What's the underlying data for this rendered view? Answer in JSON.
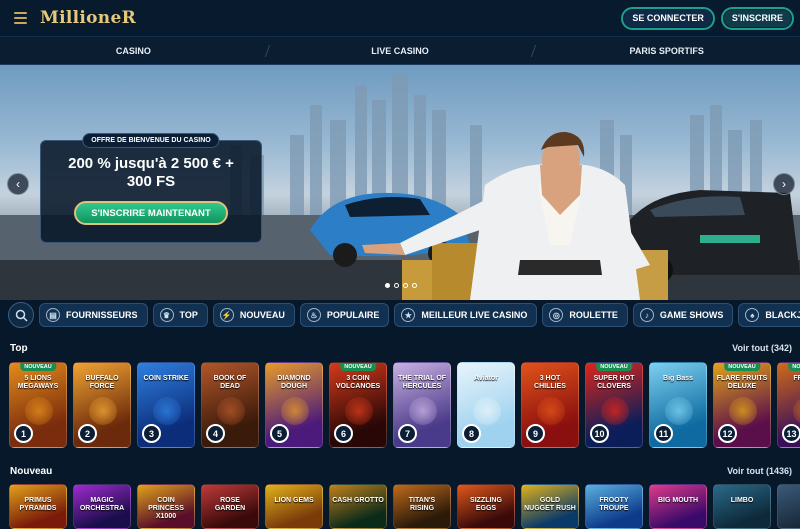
{
  "header": {
    "logo": "MillioneR",
    "login_label": "SE CONNECTER",
    "register_label": "S'INSCRIRE",
    "accent": "#1c9f8b"
  },
  "nav": {
    "items": [
      {
        "label": "CASINO"
      },
      {
        "label": "LIVE CASINO"
      },
      {
        "label": "PARIS SPORTIFS"
      }
    ]
  },
  "hero": {
    "tag": "OFFRE DE BIENVENUE DU CASINO",
    "title_line1": "200 % jusqu'à 2 500 € +",
    "title_line2": "300 FS",
    "cta": "S'INSCRIRE MAINTENANT",
    "prev_icon": "chevron-left-icon",
    "next_icon": "chevron-right-icon",
    "slide_dots": 4,
    "active_dot": 1
  },
  "filters": {
    "search_icon": "search-icon",
    "chips": [
      {
        "label": "FOURNISSEURS",
        "icon": "providers-icon",
        "glyph": "▤"
      },
      {
        "label": "TOP",
        "icon": "crown-icon",
        "glyph": "♛"
      },
      {
        "label": "NOUVEAU",
        "icon": "lightning-icon",
        "glyph": "⚡"
      },
      {
        "label": "POPULAIRE",
        "icon": "flame-icon",
        "glyph": "♨"
      },
      {
        "label": "MEILLEUR LIVE CASINO",
        "icon": "star-icon",
        "glyph": "★"
      },
      {
        "label": "ROULETTE",
        "icon": "roulette-icon",
        "glyph": "◎"
      },
      {
        "label": "GAME SHOWS",
        "icon": "microphone-icon",
        "glyph": "♪"
      },
      {
        "label": "BLACKJACK",
        "icon": "cards-icon",
        "glyph": "♠"
      }
    ]
  },
  "top": {
    "title": "Top",
    "more": "Voir tout (342)",
    "games": [
      {
        "name": "5 LIONS MEGAWAYS",
        "new": true,
        "rank": "1",
        "c1": "#7a2c0d",
        "c2": "#e38b1c"
      },
      {
        "name": "BUFFALO FORCE",
        "new": false,
        "rank": "2",
        "c1": "#6b2a0b",
        "c2": "#f0a432"
      },
      {
        "name": "COIN STRIKE",
        "new": false,
        "rank": "3",
        "c1": "#0b2d7a",
        "c2": "#2f7fe0"
      },
      {
        "name": "BOOK OF DEAD",
        "new": false,
        "rank": "4",
        "c1": "#3a1a0a",
        "c2": "#b2562a"
      },
      {
        "name": "DIAMOND DOUGH",
        "new": false,
        "rank": "5",
        "c1": "#4b1a7a",
        "c2": "#e79a2a"
      },
      {
        "name": "3 COIN VOLCANOES",
        "new": true,
        "rank": "6",
        "c1": "#2a0707",
        "c2": "#d43a1a"
      },
      {
        "name": "THE TRIAL OF HERCULES",
        "new": false,
        "rank": "7",
        "c1": "#4a3a8a",
        "c2": "#c8b0e0"
      },
      {
        "name": "Aviator",
        "new": false,
        "rank": "8",
        "c1": "#9fd2ef",
        "c2": "#e8f4fb"
      },
      {
        "name": "3 HOT CHILLIES",
        "new": false,
        "rank": "9",
        "c1": "#8a0f0f",
        "c2": "#e0531a"
      },
      {
        "name": "SUPER HOT CLOVERS",
        "new": true,
        "rank": "10",
        "c1": "#0b1e5a",
        "c2": "#e0251a"
      },
      {
        "name": "Big Bass",
        "new": false,
        "rank": "11",
        "c1": "#0e6aa0",
        "c2": "#7cd0f0"
      },
      {
        "name": "FLARE FRUITS DELUXE",
        "new": true,
        "rank": "12",
        "c1": "#5a0e4a",
        "c2": "#e0a21a"
      },
      {
        "name": "FRUITS",
        "new": true,
        "rank": "13",
        "c1": "#3a0e5a",
        "c2": "#d06a1a"
      }
    ]
  },
  "new_section": {
    "title": "Nouveau",
    "more": "Voir tout (1436)",
    "games": [
      {
        "name": "PRIMUS PYRAMIDS",
        "c1": "#7a1a0a",
        "c2": "#e0a21a"
      },
      {
        "name": "MAGIC ORCHESTRA",
        "c1": "#1a0e4a",
        "c2": "#a02ad0"
      },
      {
        "name": "COIN PRINCESS X1000",
        "c1": "#5a0e2a",
        "c2": "#e0a21a"
      },
      {
        "name": "ROSE GARDEN",
        "c1": "#3a0a0a",
        "c2": "#c03a3a"
      },
      {
        "name": "LION GEMS",
        "c1": "#7a3a0a",
        "c2": "#e0b21a"
      },
      {
        "name": "CASH GROTTO",
        "c1": "#0a2a1a",
        "c2": "#c0801a"
      },
      {
        "name": "TITAN'S RISING",
        "c1": "#2a1a0a",
        "c2": "#c06a1a"
      },
      {
        "name": "SIZZLING EGGS",
        "c1": "#3a0a0a",
        "c2": "#e0581a"
      },
      {
        "name": "GOLD NUGGET RUSH",
        "c1": "#0a3a6a",
        "c2": "#e0b21a"
      },
      {
        "name": "FROOTY TROUPE",
        "c1": "#0e3a8a",
        "c2": "#5ab0e0"
      },
      {
        "name": "BIG MOUTH",
        "c1": "#3a0a6a",
        "c2": "#e03a8a"
      },
      {
        "name": "LIMBO",
        "c1": "#0e2a3a",
        "c2": "#2a6a8a"
      },
      {
        "name": "",
        "c1": "#1a2a3a",
        "c2": "#3a5a7a"
      }
    ]
  }
}
